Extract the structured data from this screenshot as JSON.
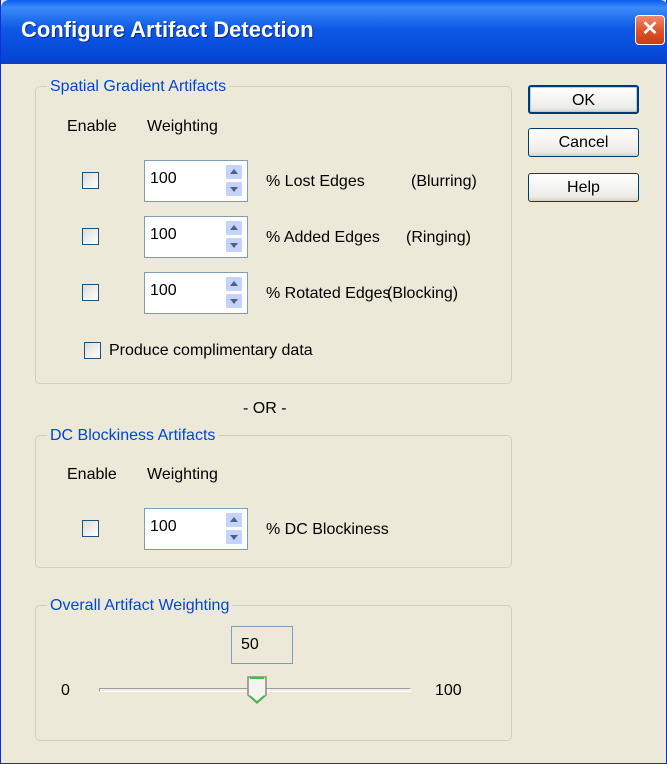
{
  "window": {
    "title": "Configure Artifact Detection",
    "close_glyph": "✕"
  },
  "buttons": {
    "ok": "OK",
    "cancel": "Cancel",
    "help": "Help"
  },
  "spatial": {
    "label": "Spatial Gradient Artifacts",
    "enable_header": "Enable",
    "weighting_header": "Weighting",
    "rows": [
      {
        "enabled": false,
        "weight": "100",
        "label": "% Lost Edges",
        "note": "(Blurring)"
      },
      {
        "enabled": false,
        "weight": "100",
        "label": "% Added Edges",
        "note": "(Ringing)"
      },
      {
        "enabled": false,
        "weight": "100",
        "label": "% Rotated Edges",
        "note": "(Blocking)"
      }
    ],
    "complimentary": {
      "checked": false,
      "label": "Produce complimentary data"
    }
  },
  "or_divider": "- OR -",
  "dc": {
    "label": "DC Blockiness Artifacts",
    "enable_header": "Enable",
    "weighting_header": "Weighting",
    "row": {
      "enabled": false,
      "weight": "100",
      "label": "% DC Blockiness"
    }
  },
  "overall": {
    "label": "Overall Artifact Weighting",
    "value": "50",
    "min": "0",
    "max": "100"
  },
  "colors": {
    "group_label": "#0046d5",
    "titlebar": "#0a5df2",
    "background": "#ece9d8"
  }
}
